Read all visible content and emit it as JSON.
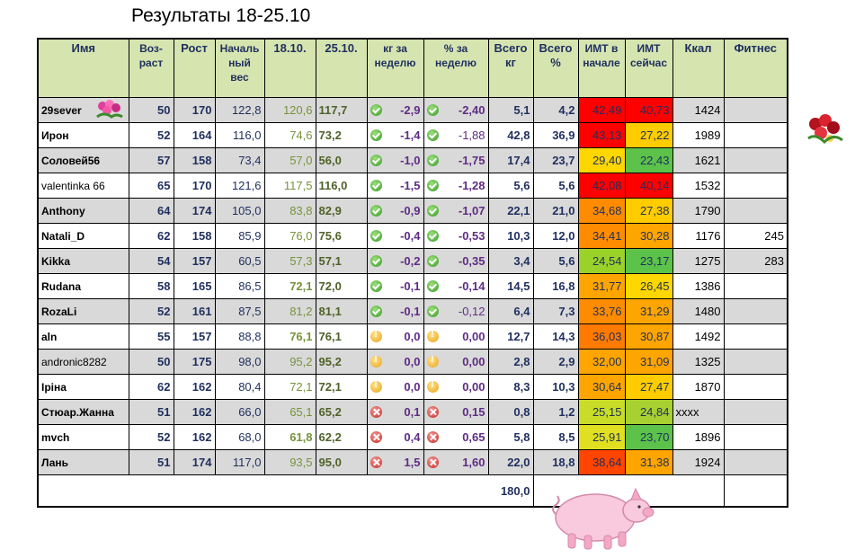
{
  "title": "Результаты  18-25.10",
  "headers": {
    "name": "Имя",
    "age": "Воз-раст",
    "height": "Рост",
    "start": "Началь ный вес",
    "w1": "18.10.",
    "w2": "25.10.",
    "kg_week": "кг за неделю",
    "pct_week": "% за неделю",
    "total_kg": "Всего кг",
    "total_pct": "Всего %",
    "imt_start": "ИМТ в начале",
    "imt_now": "ИМТ сейчас",
    "kcal": "Ккал",
    "fitness": "Фитнес"
  },
  "rows": [
    {
      "name": "29sever",
      "age": "50",
      "height": "170",
      "start": "122,8",
      "w1": "120,6",
      "w2": "117,7",
      "status": "ok",
      "kg": "-2,9",
      "pct": "-2,40",
      "tkg": "5,1",
      "tpct": "4,2",
      "imt1": "42,49",
      "imt1_color": "#ff0000",
      "imt2": "40,73",
      "imt2_color": "#ff0000",
      "kcal": "1424",
      "fit": ""
    },
    {
      "name": "Ирон",
      "age": "52",
      "height": "164",
      "start": "116,0",
      "w1": "74,6",
      "w2": "73,2",
      "status": "ok",
      "kg": "-1,4",
      "pct": "-1,88",
      "tkg": "42,8",
      "tpct": "36,9",
      "imt1": "43,13",
      "imt1_color": "#ff0000",
      "imt2": "27,22",
      "imt2_color": "#ffcc00",
      "kcal": "1989",
      "fit": ""
    },
    {
      "name": "Соловей56",
      "age": "57",
      "height": "158",
      "start": "73,4",
      "w1": "57,0",
      "w2": "56,0",
      "status": "ok",
      "kg": "-1,0",
      "pct": "-1,75",
      "tkg": "17,4",
      "tpct": "23,7",
      "imt1": "29,40",
      "imt1_color": "#ffd700",
      "imt2": "22,43",
      "imt2_color": "#5cc24a",
      "kcal": "1621",
      "fit": ""
    },
    {
      "name": "valentinka 66",
      "age": "65",
      "height": "170",
      "start": "121,6",
      "w1": "117,5",
      "w2": "116,0",
      "status": "ok",
      "kg": "-1,5",
      "pct": "-1,28",
      "tkg": "5,6",
      "tpct": "5,6",
      "imt1": "42,08",
      "imt1_color": "#ff0000",
      "imt2": "40,14",
      "imt2_color": "#ff0000",
      "kcal": "1532",
      "fit": ""
    },
    {
      "name": "Anthony",
      "age": "64",
      "height": "174",
      "start": "105,0",
      "w1": "83,8",
      "w2": "82,9",
      "status": "ok",
      "kg": "-0,9",
      "pct": "-1,07",
      "tkg": "22,1",
      "tpct": "21,0",
      "imt1": "34,68",
      "imt1_color": "#ff8c00",
      "imt2": "27,38",
      "imt2_color": "#ffcc00",
      "kcal": "1790",
      "fit": ""
    },
    {
      "name": "Natali_D",
      "age": "62",
      "height": "158",
      "start": "85,9",
      "w1": "76,0",
      "w2": "75,6",
      "status": "ok",
      "kg": "-0,4",
      "pct": "-0,53",
      "tkg": "10,3",
      "tpct": "12,0",
      "imt1": "34,41",
      "imt1_color": "#ff8c00",
      "imt2": "30,28",
      "imt2_color": "#ffa500",
      "kcal": "1176",
      "fit": "245"
    },
    {
      "name": "Kikka",
      "age": "54",
      "height": "157",
      "start": "60,5",
      "w1": "57,3",
      "w2": "57,1",
      "status": "ok",
      "kg": "-0,2",
      "pct": "-0,35",
      "tkg": "3,4",
      "tpct": "5,6",
      "imt1": "24,54",
      "imt1_color": "#9bd22a",
      "imt2": "23,17",
      "imt2_color": "#5cc24a",
      "kcal": "1275",
      "fit": "283"
    },
    {
      "name": "Rudana",
      "age": "58",
      "height": "165",
      "start": "86,5",
      "w1": "72,1",
      "w2": "72,0",
      "status": "ok",
      "kg": "-0,1",
      "pct": "-0,14",
      "tkg": "14,5",
      "tpct": "16,8",
      "imt1": "31,77",
      "imt1_color": "#ffa500",
      "imt2": "26,45",
      "imt2_color": "#ffd700",
      "kcal": "1386",
      "fit": ""
    },
    {
      "name": "RozaLi",
      "age": "52",
      "height": "161",
      "start": "87,5",
      "w1": "81,2",
      "w2": "81,1",
      "status": "ok",
      "kg": "-0,1",
      "pct": "-0,12",
      "tkg": "6,4",
      "tpct": "7,3",
      "imt1": "33,76",
      "imt1_color": "#ff8c00",
      "imt2": "31,29",
      "imt2_color": "#ffa500",
      "kcal": "1480",
      "fit": ""
    },
    {
      "name": "aln",
      "age": "55",
      "height": "157",
      "start": "88,8",
      "w1": "76,1",
      "w2": "76,1",
      "status": "neu",
      "kg": "0,0",
      "pct": "0,00",
      "tkg": "12,7",
      "tpct": "14,3",
      "imt1": "36,03",
      "imt1_color": "#ff7a00",
      "imt2": "30,87",
      "imt2_color": "#ffa500",
      "kcal": "1492",
      "fit": ""
    },
    {
      "name": "andronic8282",
      "age": "50",
      "height": "175",
      "start": "98,0",
      "w1": "95,2",
      "w2": "95,2",
      "status": "neu",
      "kg": "0,0",
      "pct": "0,00",
      "tkg": "2,8",
      "tpct": "2,9",
      "imt1": "32,00",
      "imt1_color": "#ffa500",
      "imt2": "31,09",
      "imt2_color": "#ffa500",
      "kcal": "1325",
      "fit": ""
    },
    {
      "name": "Іріна",
      "age": "62",
      "height": "162",
      "start": "80,4",
      "w1": "72,1",
      "w2": "72,1",
      "status": "neu",
      "kg": "0,0",
      "pct": "0,00",
      "tkg": "8,3",
      "tpct": "10,3",
      "imt1": "30,64",
      "imt1_color": "#ffa500",
      "imt2": "27,47",
      "imt2_color": "#ffcc00",
      "kcal": "1870",
      "fit": ""
    },
    {
      "name": "Стюар.Жанна",
      "age": "51",
      "height": "162",
      "start": "66,0",
      "w1": "65,1",
      "w2": "65,2",
      "status": "bad",
      "kg": "0,1",
      "pct": "0,15",
      "tkg": "0,8",
      "tpct": "1,2",
      "imt1": "25,15",
      "imt1_color": "#c8dc28",
      "imt2": "24,84",
      "imt2_color": "#a8d030",
      "kcal": "xxxx",
      "fit": ""
    },
    {
      "name": "mvch",
      "age": "52",
      "height": "162",
      "start": "68,0",
      "w1": "61,8",
      "w2": "62,2",
      "status": "bad",
      "kg": "0,4",
      "pct": "0,65",
      "tkg": "5,8",
      "tpct": "8,5",
      "imt1": "25,91",
      "imt1_color": "#e0e020",
      "imt2": "23,70",
      "imt2_color": "#5cc24a",
      "kcal": "1896",
      "fit": ""
    },
    {
      "name": "Лань",
      "age": "51",
      "height": "174",
      "start": "117,0",
      "w1": "93,5",
      "w2": "95,0",
      "status": "bad",
      "kg": "1,5",
      "pct": "1,60",
      "tkg": "22,0",
      "tpct": "18,8",
      "imt1": "38,64",
      "imt1_color": "#ff4500",
      "imt2": "31,38",
      "imt2_color": "#ffa500",
      "kcal": "1924",
      "fit": ""
    }
  ],
  "total": {
    "value": "180,0"
  },
  "icons": {
    "ok": "check-circle-icon",
    "neu": "exclamation-circle-icon",
    "bad": "cross-circle-icon"
  }
}
